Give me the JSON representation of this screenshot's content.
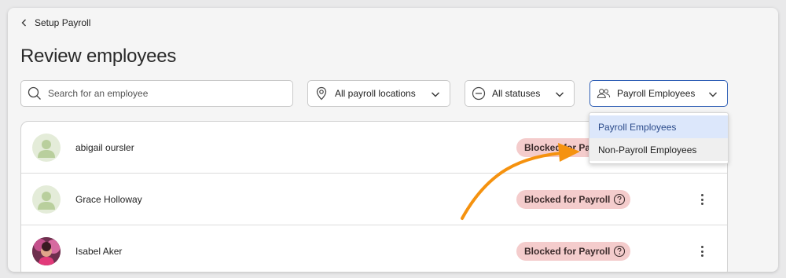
{
  "nav": {
    "back_label": "Setup Payroll"
  },
  "page": {
    "title": "Review employees"
  },
  "filters": {
    "search_placeholder": "Search for an employee",
    "location_label": "All payroll locations",
    "status_label": "All statuses",
    "employee_type_label": "Payroll Employees"
  },
  "dropdown": {
    "options": [
      {
        "label": "Payroll Employees",
        "selected": true
      },
      {
        "label": "Non-Payroll Employees",
        "selected": false
      }
    ]
  },
  "employees": [
    {
      "name": "abigail oursler",
      "status": "Blocked for Payroll",
      "avatar": "default-person"
    },
    {
      "name": "Grace Holloway",
      "status": "Blocked for Payroll",
      "avatar": "default-person"
    },
    {
      "name": "Isabel Aker",
      "status": "Blocked for Payroll",
      "avatar": "photo"
    }
  ],
  "colors": {
    "accent_blue": "#2f5fb5",
    "badge_bg": "#f4cccc",
    "annotation_arrow": "#f5920f",
    "avatar_default": "#b9cf9d"
  }
}
